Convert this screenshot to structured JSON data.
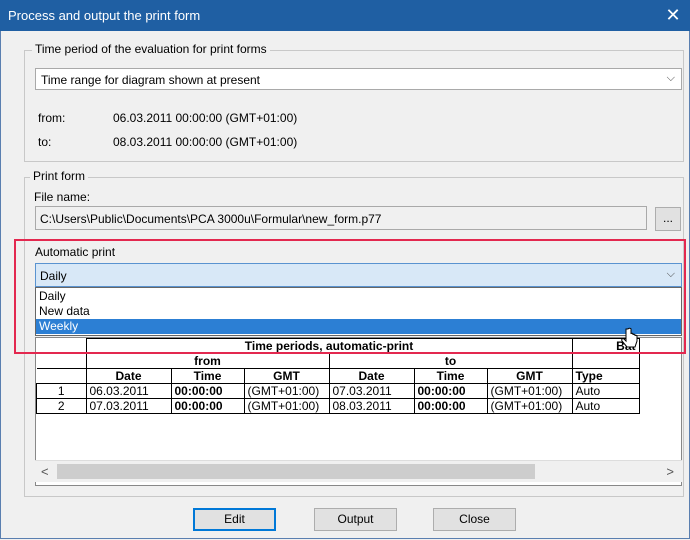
{
  "window": {
    "title": "Process and output the print form",
    "close_glyph": "✕"
  },
  "period": {
    "legend": "Time period of the evaluation for print forms",
    "combo_value": "Time range for diagram shown at present",
    "from_label": "from:",
    "from_value": "06.03.2011 00:00:00 (GMT+01:00)",
    "to_label": "to:",
    "to_value": "08.03.2011 00:00:00 (GMT+01:00)"
  },
  "print_form": {
    "legend": "Print form",
    "file_label": "File name:",
    "file_value": "C:\\Users\\Public\\Documents\\PCA 3000u\\Formular\\new_form.p77",
    "browse_label": "...",
    "auto_label": "Automatic print",
    "auto_value": "Daily",
    "options": [
      "Daily",
      "New data",
      "Weekly"
    ]
  },
  "table": {
    "group_header": "Time periods, automatic-print",
    "from_header": "from",
    "to_header": "to",
    "bat_header": "Bat",
    "columns": [
      "Date",
      "Time",
      "GMT",
      "Date",
      "Time",
      "GMT",
      "Type"
    ],
    "rows": [
      {
        "num": "1",
        "cells": [
          "06.03.2011",
          "00:00:00",
          "(GMT+01:00)",
          "07.03.2011",
          "00:00:00",
          "(GMT+01:00)",
          "Auto"
        ]
      },
      {
        "num": "2",
        "cells": [
          "07.03.2011",
          "00:00:00",
          "(GMT+01:00)",
          "08.03.2011",
          "00:00:00",
          "(GMT+01:00)",
          "Auto"
        ]
      }
    ]
  },
  "scroll": {
    "left": "<",
    "right": ">"
  },
  "buttons": {
    "edit": "Edit",
    "output": "Output",
    "close": "Close"
  },
  "colors": {
    "title_bar": "#1f5fa3",
    "highlight": "#e3284f",
    "selection": "#2c7fd4"
  }
}
